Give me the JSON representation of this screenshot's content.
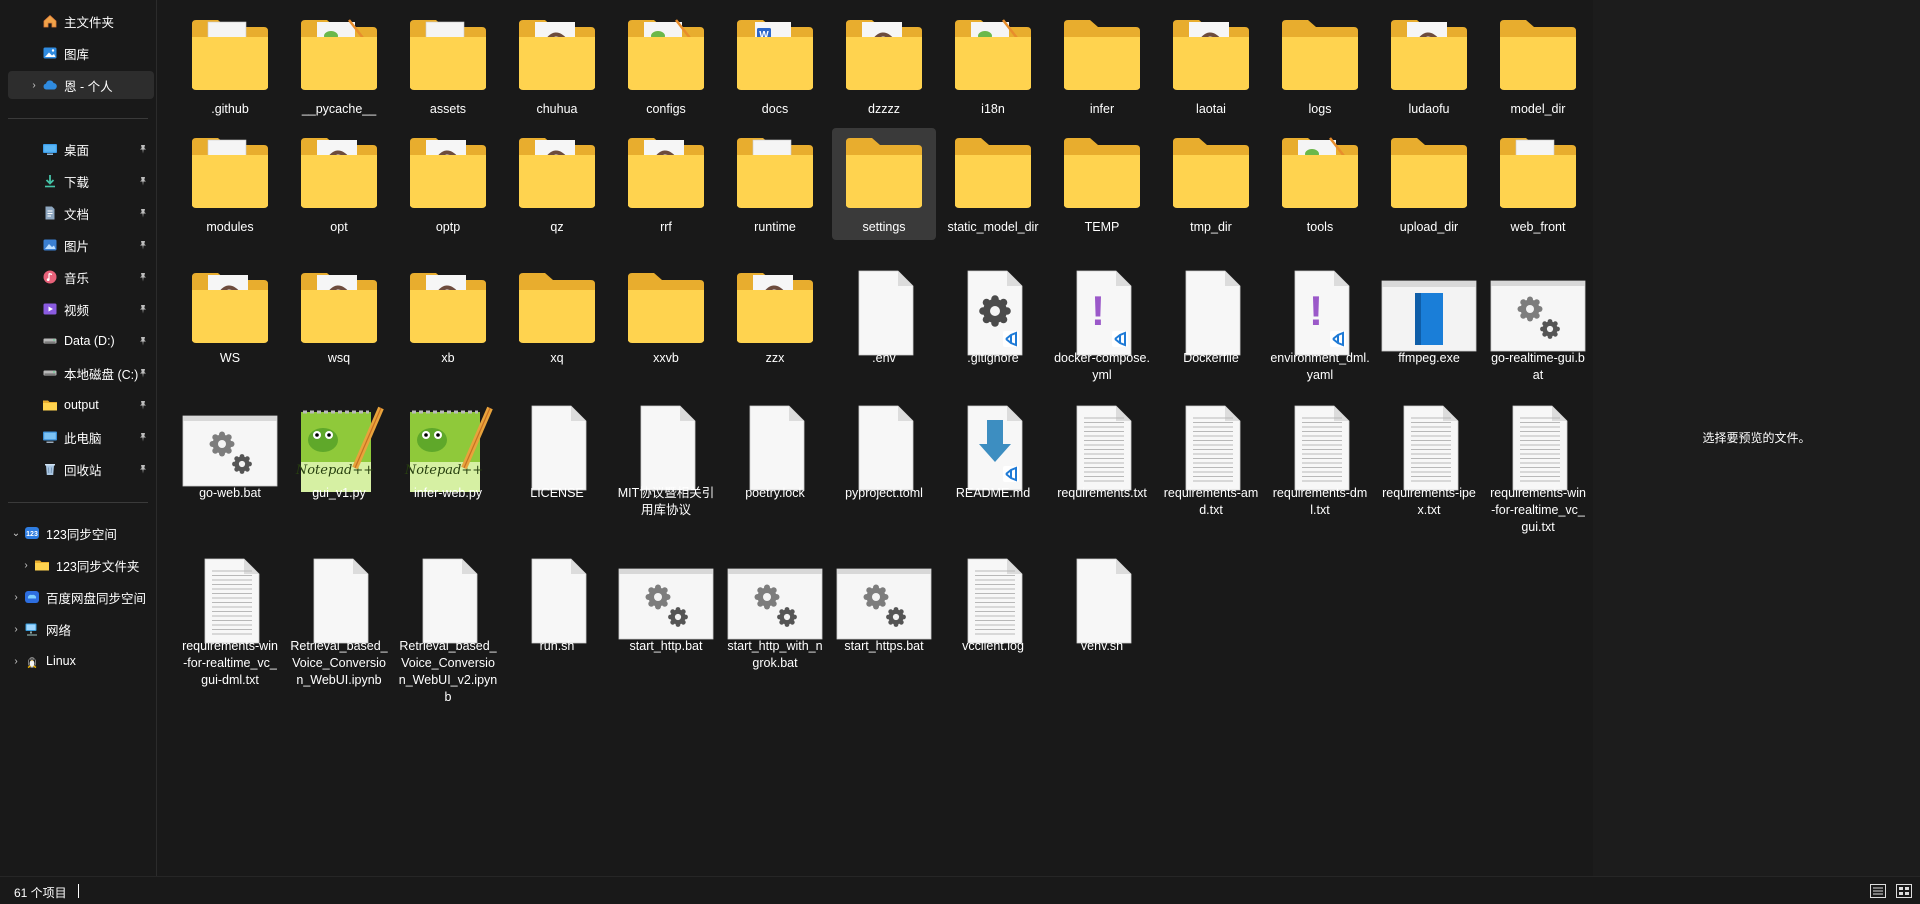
{
  "sidebar": {
    "top": [
      {
        "label": "主文件夹",
        "icon": "home-icon"
      },
      {
        "label": "图库",
        "icon": "gallery-icon"
      },
      {
        "label": "恩 - 个人",
        "icon": "onedrive-cloud-icon",
        "expandable": true,
        "selected": true
      }
    ],
    "quick_access": [
      {
        "label": "桌面",
        "icon": "desktop-icon",
        "pinned": true
      },
      {
        "label": "下载",
        "icon": "download-icon",
        "pinned": true
      },
      {
        "label": "文档",
        "icon": "documents-icon",
        "pinned": true
      },
      {
        "label": "图片",
        "icon": "pictures-icon",
        "pinned": true
      },
      {
        "label": "音乐",
        "icon": "music-icon",
        "pinned": true
      },
      {
        "label": "视频",
        "icon": "videos-icon",
        "pinned": true
      },
      {
        "label": "Data (D:)",
        "icon": "drive-icon",
        "pinned": true
      },
      {
        "label": "本地磁盘 (C:)",
        "icon": "drive-icon",
        "pinned": true
      },
      {
        "label": "output",
        "icon": "folder-icon",
        "pinned": true
      },
      {
        "label": "此电脑",
        "icon": "computer-icon",
        "pinned": true
      },
      {
        "label": "回收站",
        "icon": "recycle-bin-icon",
        "pinned": true
      }
    ],
    "tree": [
      {
        "label": "123同步空间",
        "icon": "sync-123-icon",
        "state": "expanded",
        "level": 0
      },
      {
        "label": "123同步文件夹",
        "icon": "folder-icon",
        "state": "collapsed",
        "level": 1
      },
      {
        "label": "百度网盘同步空间",
        "icon": "baidu-netdisk-icon",
        "state": "collapsed",
        "level": 0
      },
      {
        "label": "网络",
        "icon": "network-icon",
        "state": "collapsed",
        "level": 0
      },
      {
        "label": "Linux",
        "icon": "linux-icon",
        "state": "collapsed",
        "level": 0
      }
    ]
  },
  "files": [
    {
      "name": ".github",
      "type": "folder-doc"
    },
    {
      "name": "__pycache__",
      "type": "folder-py"
    },
    {
      "name": "assets",
      "type": "folder-doc"
    },
    {
      "name": "chuhua",
      "type": "folder-arc"
    },
    {
      "name": "configs",
      "type": "folder-py"
    },
    {
      "name": "docs",
      "type": "folder-word"
    },
    {
      "name": "dzzzz",
      "type": "folder-arc"
    },
    {
      "name": "i18n",
      "type": "folder-py"
    },
    {
      "name": "infer",
      "type": "folder"
    },
    {
      "name": "laotai",
      "type": "folder-arc"
    },
    {
      "name": "logs",
      "type": "folder"
    },
    {
      "name": "ludaofu",
      "type": "folder-arc"
    },
    {
      "name": "model_dir",
      "type": "folder"
    },
    {
      "name": "modules",
      "type": "folder-doc"
    },
    {
      "name": "opt",
      "type": "folder-arc"
    },
    {
      "name": "optp",
      "type": "folder-arc"
    },
    {
      "name": "qz",
      "type": "folder-arc"
    },
    {
      "name": "rrf",
      "type": "folder-arc"
    },
    {
      "name": "runtime",
      "type": "folder-doc"
    },
    {
      "name": "settings",
      "type": "folder",
      "selected": true
    },
    {
      "name": "static_model_dir",
      "type": "folder"
    },
    {
      "name": "TEMP",
      "type": "folder"
    },
    {
      "name": "tmp_dir",
      "type": "folder"
    },
    {
      "name": "tools",
      "type": "folder-py"
    },
    {
      "name": "upload_dir",
      "type": "folder"
    },
    {
      "name": "web_front",
      "type": "folder-doc"
    },
    {
      "name": "WS",
      "type": "folder-arc"
    },
    {
      "name": "wsq",
      "type": "folder-arc"
    },
    {
      "name": "xb",
      "type": "folder-arc"
    },
    {
      "name": "xq",
      "type": "folder"
    },
    {
      "name": "xxvb",
      "type": "folder"
    },
    {
      "name": "zzx",
      "type": "folder-arc"
    },
    {
      "name": ".env",
      "type": "blank"
    },
    {
      "name": ".gitignore",
      "type": "gear-vscode"
    },
    {
      "name": "docker-compose.yml",
      "type": "yaml"
    },
    {
      "name": "Dockerfile",
      "type": "blank"
    },
    {
      "name": "environment_dml.yaml",
      "type": "yaml"
    },
    {
      "name": "ffmpeg.exe",
      "type": "exe"
    },
    {
      "name": "go-realtime-gui.bat",
      "type": "bat"
    },
    {
      "name": "go-web.bat",
      "type": "bat"
    },
    {
      "name": "gui_v1.py",
      "type": "notepad"
    },
    {
      "name": "infer-web.py",
      "type": "notepad"
    },
    {
      "name": "LICENSE",
      "type": "blank"
    },
    {
      "name": "MIT协议暨相关引用库协议",
      "type": "blank"
    },
    {
      "name": "poetry.lock",
      "type": "blank"
    },
    {
      "name": "pyproject.toml",
      "type": "blank"
    },
    {
      "name": "README.md",
      "type": "md"
    },
    {
      "name": "requirements.txt",
      "type": "txt"
    },
    {
      "name": "requirements-amd.txt",
      "type": "txt"
    },
    {
      "name": "requirements-dml.txt",
      "type": "txt"
    },
    {
      "name": "requirements-ipex.txt",
      "type": "txt"
    },
    {
      "name": "requirements-win-for-realtime_vc_gui.txt",
      "type": "txt"
    },
    {
      "name": "requirements-win-for-realtime_vc_gui-dml.txt",
      "type": "txt"
    },
    {
      "name": "Retrieval_based_Voice_Conversion_WebUI.ipynb",
      "type": "blank"
    },
    {
      "name": "Retrieval_based_Voice_Conversion_WebUI_v2.ipynb",
      "type": "blank"
    },
    {
      "name": "run.sh",
      "type": "blank"
    },
    {
      "name": "start_http.bat",
      "type": "bat"
    },
    {
      "name": "start_http_with_ngrok.bat",
      "type": "bat"
    },
    {
      "name": "start_https.bat",
      "type": "bat"
    },
    {
      "name": "vcclient.log",
      "type": "txt"
    },
    {
      "name": "venv.sh",
      "type": "blank"
    }
  ],
  "preview": {
    "message": "选择要预览的文件。"
  },
  "status": {
    "item_count": "61 个项目"
  },
  "view_buttons": [
    {
      "icon": "details-view-icon"
    },
    {
      "icon": "large-icons-view-icon"
    }
  ],
  "colors": {
    "background": "#191919",
    "folder_back": "#e8ad2e",
    "folder_front": "#ffd34f",
    "selection": "#3a3a3a",
    "vscode_blue": "#1e7ad6",
    "yaml_purple": "#9b59c9"
  }
}
